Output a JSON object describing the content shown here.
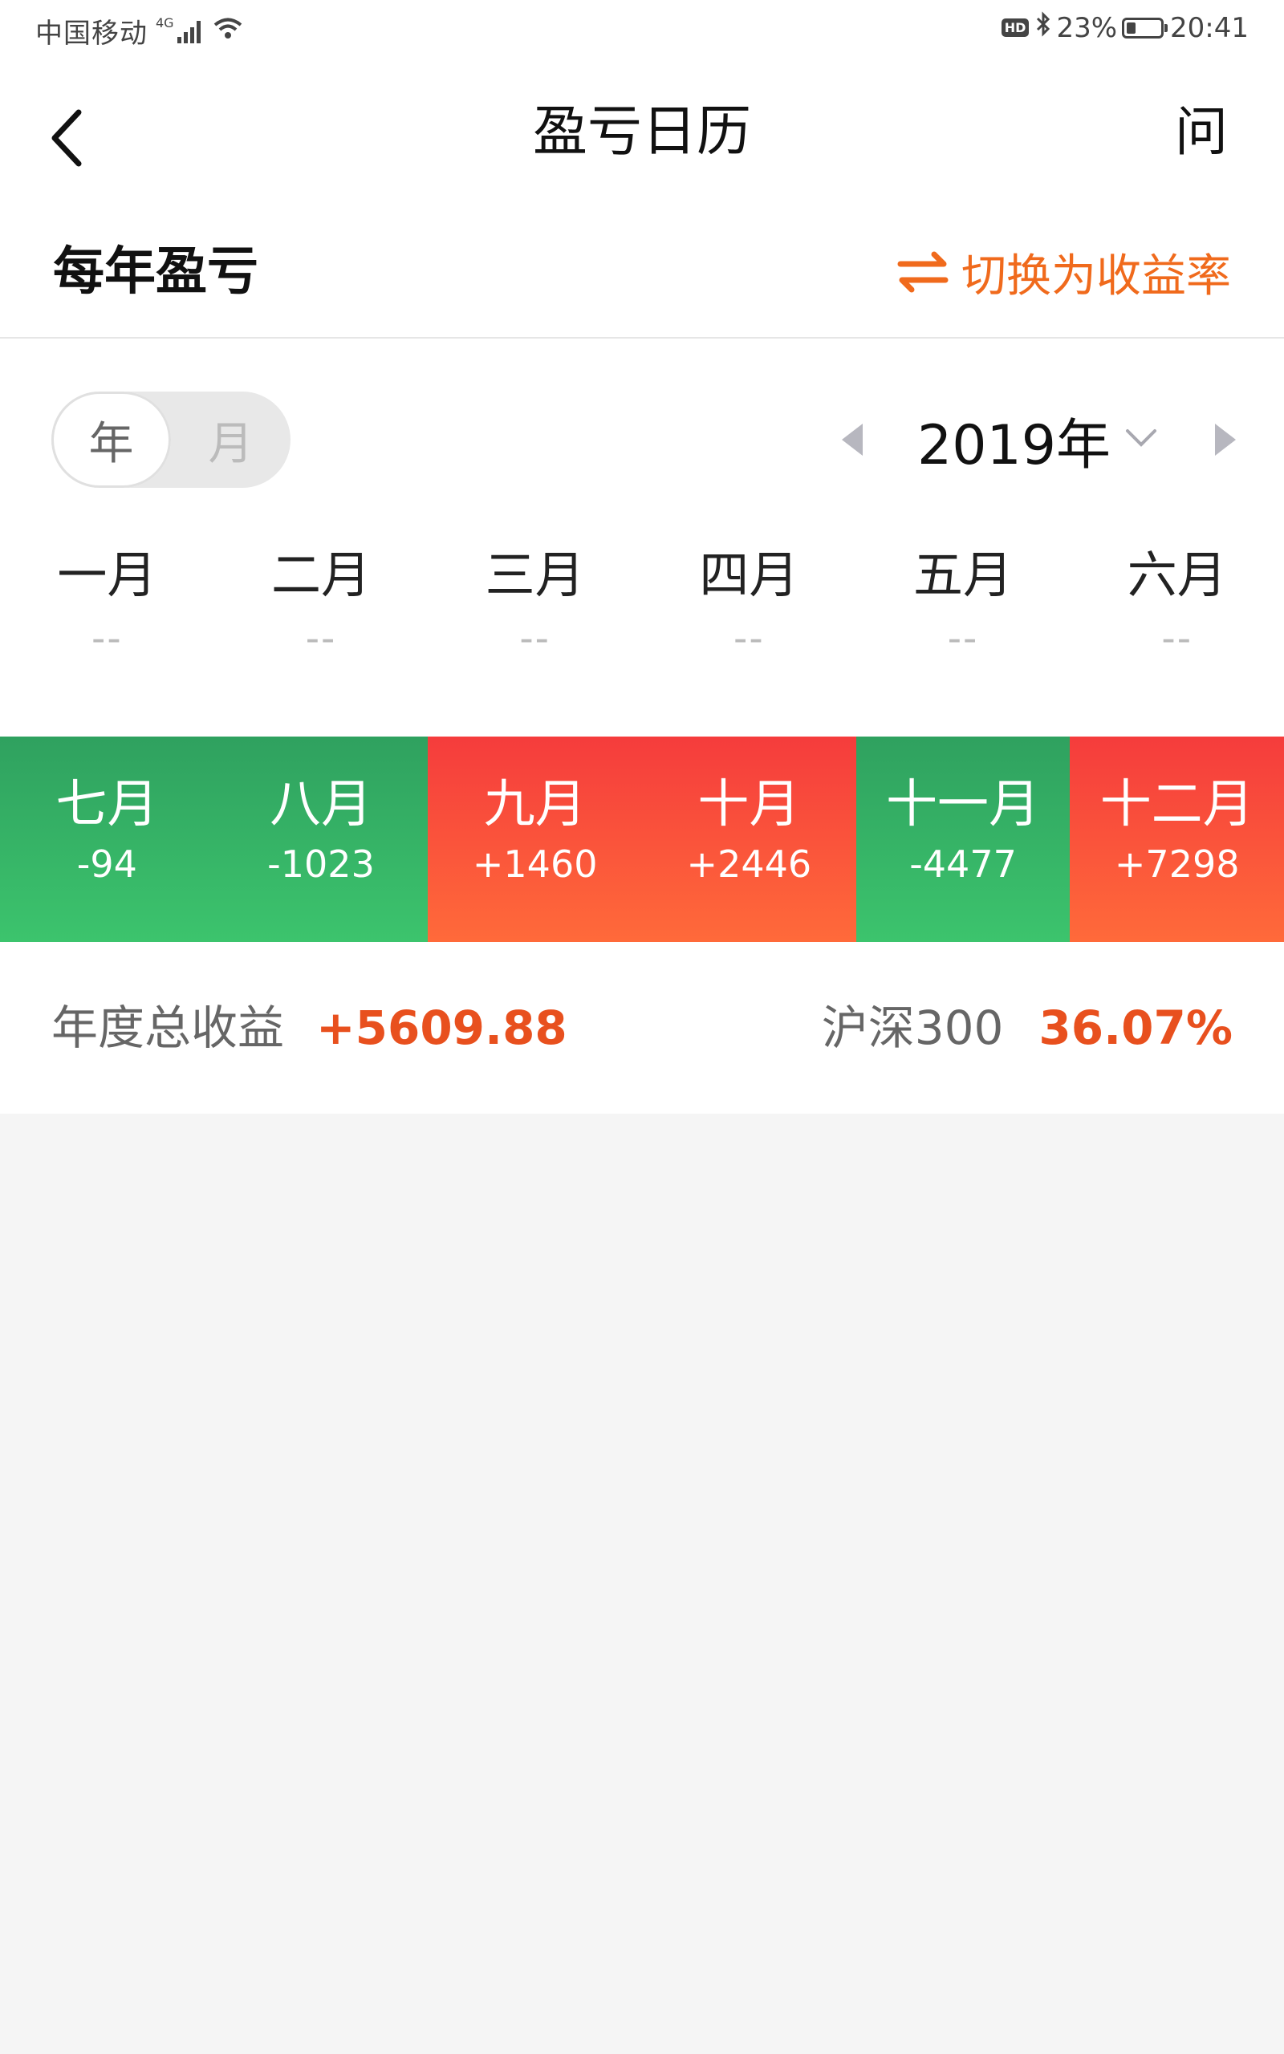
{
  "status_bar": {
    "carrier": "中国移动",
    "network": "4G",
    "hd": "HD",
    "battery": "23%",
    "time": "20:41"
  },
  "header": {
    "title": "盈亏日历",
    "help": "问"
  },
  "section": {
    "title": "每年盈亏",
    "switch_label": "切换为收益率"
  },
  "controls": {
    "toggle": [
      "年",
      "月"
    ],
    "active_toggle": "年",
    "year": "2019年"
  },
  "months": [
    {
      "name": "一月",
      "value": "--"
    },
    {
      "name": "二月",
      "value": "--"
    },
    {
      "name": "三月",
      "value": "--"
    },
    {
      "name": "四月",
      "value": "--"
    },
    {
      "name": "五月",
      "value": "--"
    },
    {
      "name": "六月",
      "value": "--"
    },
    {
      "name": "七月",
      "value": "-94",
      "trend": "loss"
    },
    {
      "name": "八月",
      "value": "-1023",
      "trend": "loss"
    },
    {
      "name": "九月",
      "value": "+1460",
      "trend": "gain"
    },
    {
      "name": "十月",
      "value": "+2446",
      "trend": "gain"
    },
    {
      "name": "十一月",
      "value": "-4477",
      "trend": "loss"
    },
    {
      "name": "十二月",
      "value": "+7298",
      "trend": "gain"
    }
  ],
  "summary": {
    "label": "年度总收益",
    "value": "+5609.88",
    "index_label": "沪深300",
    "index_value": "36.07%"
  },
  "colors": {
    "accent": "#f06a1c",
    "gain": "#f53c3c",
    "loss": "#3cc46d",
    "positive_text": "#e8501e"
  }
}
